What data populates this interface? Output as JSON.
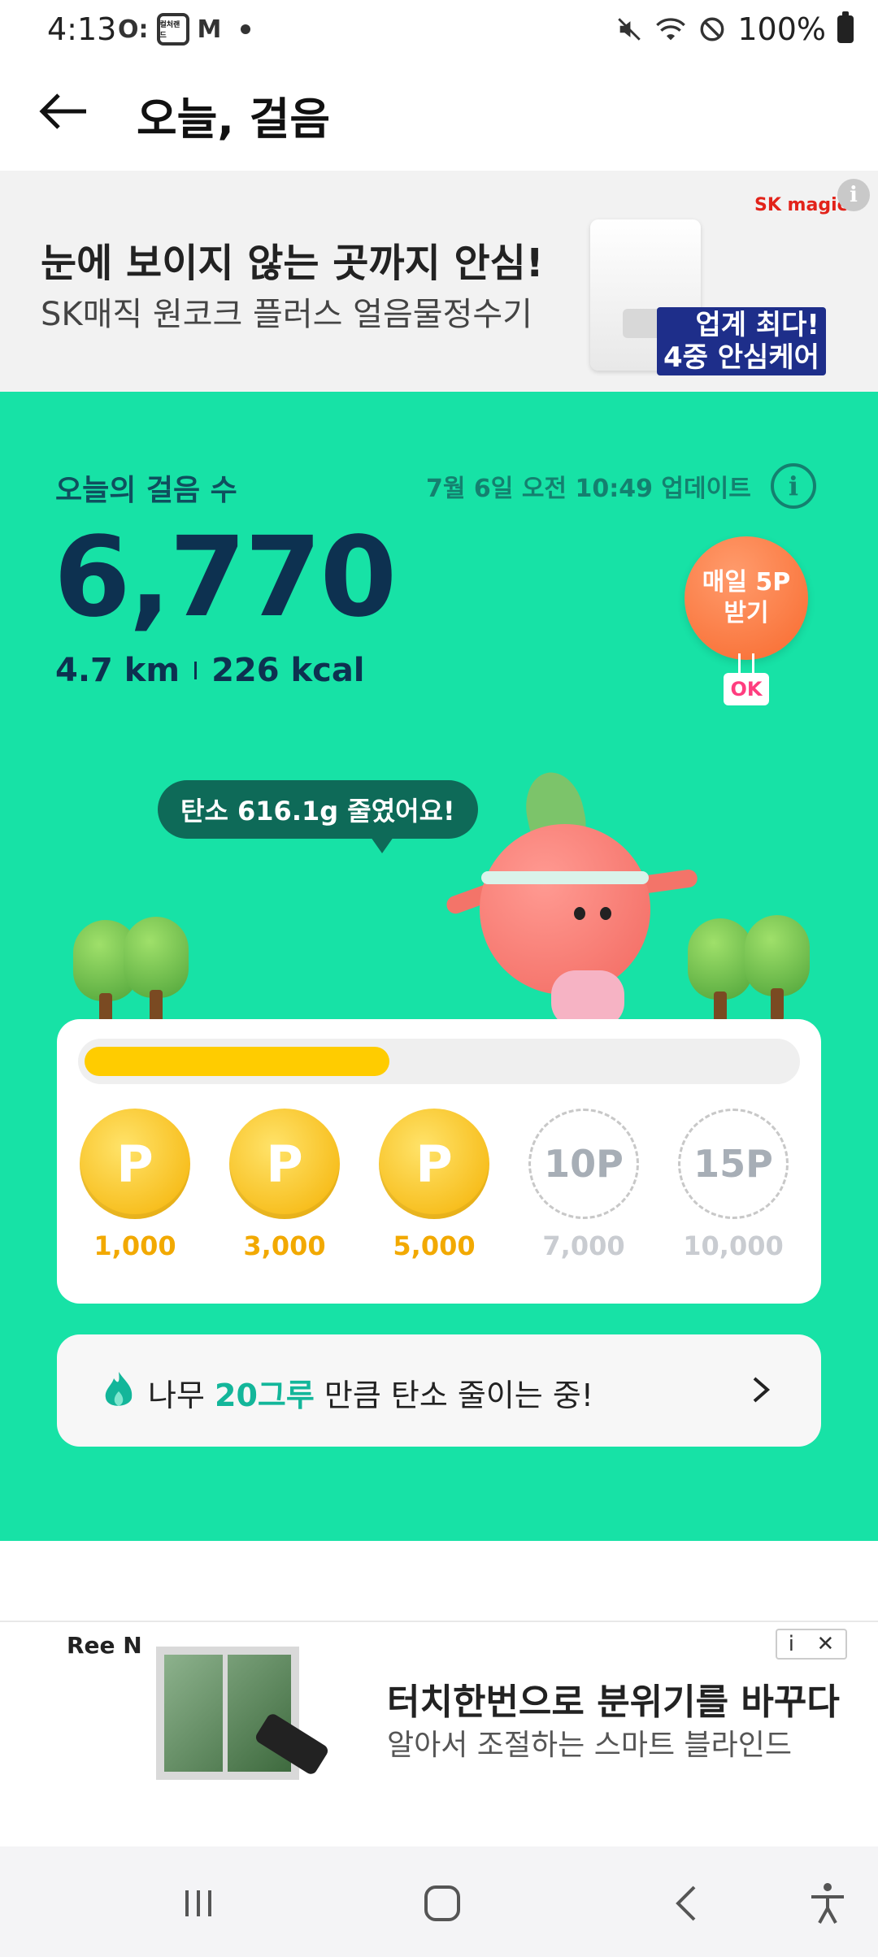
{
  "status_bar": {
    "time": "4:13",
    "left_icons": [
      "notification-icon",
      "app-icon",
      "mail-icon"
    ],
    "app_badge": "컬처랜드",
    "mail_glyph": "M",
    "battery_text": "100%"
  },
  "header": {
    "title": "오늘, 걸음"
  },
  "ad_top": {
    "title": "눈에 보이지 않는 곳까지 안심!",
    "subtitle": "SK매직 원코크 플러스 얼음물정수기",
    "brand": "SK magic",
    "tag_line1": "업계 최다!",
    "tag_line2": "4중 안심케어"
  },
  "steps": {
    "label": "오늘의 걸음 수",
    "update_text": "7월 6일 오전 10:49 업데이트",
    "count": "6,770",
    "distance": "4.7 km",
    "calories": "226 kcal",
    "daily_reward_line1": "매일 5P",
    "daily_reward_line2": "받기",
    "ok_badge": "OK",
    "carbon_message": "탄소 616.1g 줄였어요!"
  },
  "progress": {
    "fraction": 0.43,
    "color": "#ffcc00",
    "points": [
      {
        "glyph": "P",
        "value": "1,000",
        "earned": true
      },
      {
        "glyph": "P",
        "value": "3,000",
        "earned": true
      },
      {
        "glyph": "P",
        "value": "5,000",
        "earned": true
      },
      {
        "glyph": "10P",
        "value": "7,000",
        "earned": false
      },
      {
        "glyph": "15P",
        "value": "10,000",
        "earned": false
      }
    ]
  },
  "tree_card": {
    "prefix": "나무 ",
    "highlight": "20그루",
    "suffix": " 만큼 탄소 줄이는 중!"
  },
  "ad_bottom": {
    "brand": "Ree N",
    "title": "터치한번으로 분위기를 바꾸다",
    "subtitle": "알아서 조절하는 스마트 블라인드",
    "info_glyph": "i",
    "close_glyph": "✕"
  },
  "colors": {
    "green_bg": "#17e2a6",
    "steps_text": "#0d3150",
    "accent_teal": "#13b69a",
    "coin_gold": "#f4b000",
    "balloon_orange": "#f86a2e"
  }
}
